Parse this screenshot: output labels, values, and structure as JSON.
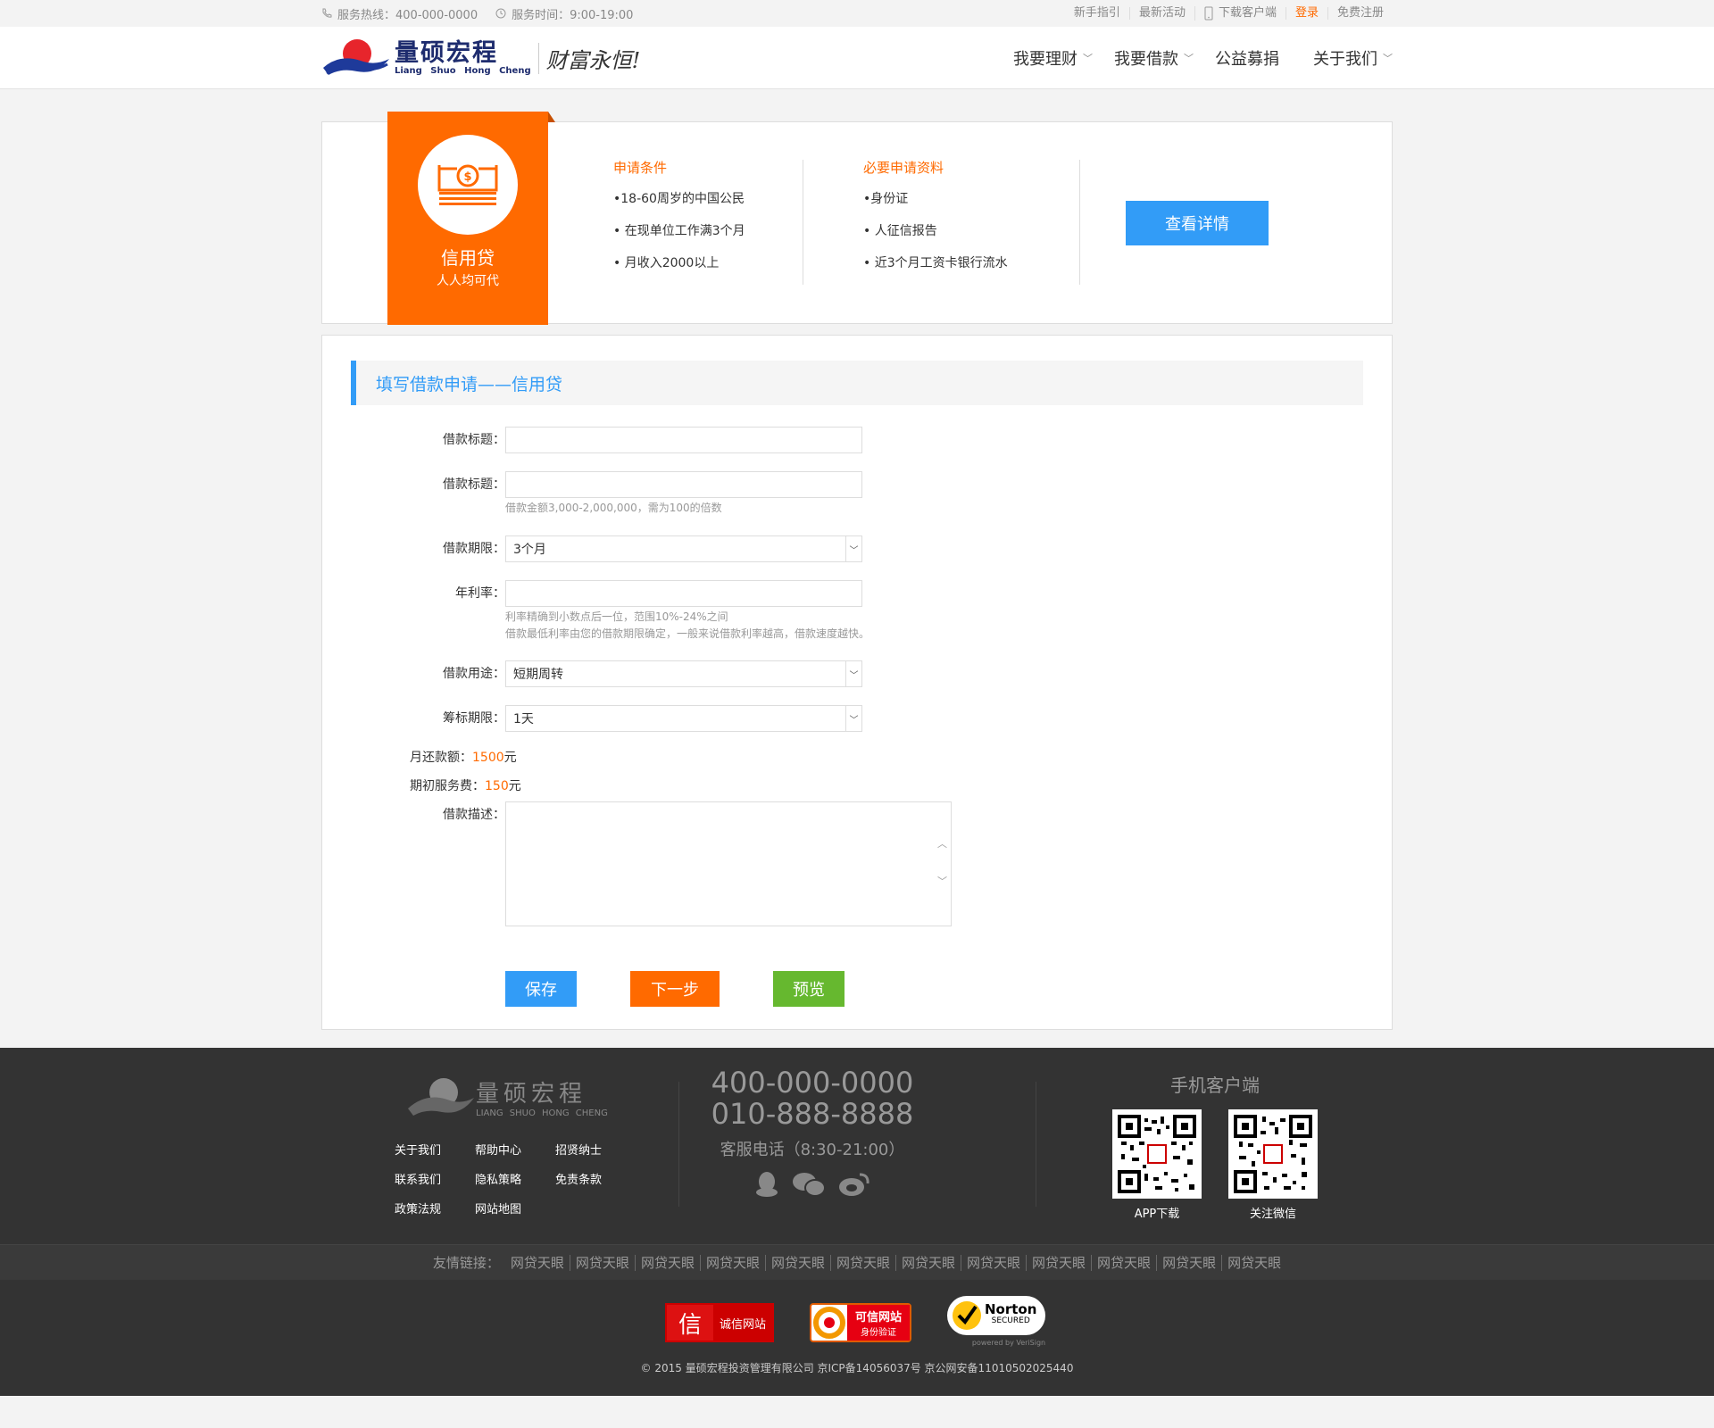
{
  "topbar": {
    "hotline": "服务热线：400-000-0000",
    "hours": "服务时间：9:00-19:00",
    "links": [
      "新手指引",
      "最新活动",
      "下载客户端",
      "登录",
      "免费注册"
    ]
  },
  "header": {
    "logo_cn": "量硕宏程",
    "logo_en": "Liang Shuo Hong Cheng",
    "slogan": "财富永恒!",
    "nav": [
      "我要理财",
      "我要借款",
      "公益募捐",
      "关于我们"
    ]
  },
  "product": {
    "name": "信用贷",
    "tagline": "人人均可代",
    "cond_title": "申请条件",
    "conditions": [
      "•18-60周岁的中国公民",
      "• 在现单位工作满3个月",
      "• 月收入2000以上"
    ],
    "doc_title": "必要申请资料",
    "documents": [
      "•身份证",
      "• 人征信报告",
      "• 近3个月工资卡银行流水"
    ],
    "detail_button": "查看详情"
  },
  "form": {
    "title": "填写借款申请——信用贷",
    "label_title": "借款标题：",
    "label_amount": "借款标题：",
    "amount_hint": "借款金额3,000-2,000,000，需为100的倍数",
    "label_term": "借款期限：",
    "term_value": "3个月",
    "label_rate": "年利率：",
    "rate_hint1": "利率精确到小数点后一位，范围10%-24%之间",
    "rate_hint2": "借款最低利率由您的借款期限确定，一般来说借款利率越高，借款速度越快。",
    "label_use": "借款用途：",
    "use_value": "短期周转",
    "label_period": "筹标期限：",
    "period_value": "1天",
    "monthly_label": "月还款额：",
    "monthly_value": "1500",
    "unit": "元",
    "fee_label": "期初服务费：",
    "fee_value": "150",
    "label_desc": "借款描述：",
    "btn_save": "保存",
    "btn_next": "下一步",
    "btn_preview": "预览"
  },
  "footer": {
    "logo_cn": "量硕宏程",
    "logo_en": "LIANG SHUO HONG CHENG",
    "links": [
      "关于我们",
      "帮助中心",
      "招贤纳士",
      "联系我们",
      "隐私策略",
      "免责条款",
      "政策法规",
      "网站地图"
    ],
    "phone1": "400-000-0000",
    "phone2": "010-888-8888",
    "service": "客服电话（8:30-21:00）",
    "app_title": "手机客户端",
    "qr1": "APP下载",
    "qr2": "关注微信",
    "friend_label": "友情链接：",
    "friend_links": [
      "网贷天眼",
      "网贷天眼",
      "网贷天眼",
      "网贷天眼",
      "网贷天眼",
      "网贷天眼",
      "网贷天眼",
      "网贷天眼",
      "网贷天眼",
      "网贷天眼",
      "网贷天眼",
      "网贷天眼"
    ],
    "cert1": "诚信网站",
    "cert2a": "可信网站",
    "cert2b": "身份验证",
    "cert3a": "Norton",
    "cert3b": "SECURED",
    "cert3c": "powered by VeriSign",
    "copyright": "© 2015 量硕宏程投资管理有限公司 京ICP备14056037号 京公网安备11010502025440"
  }
}
